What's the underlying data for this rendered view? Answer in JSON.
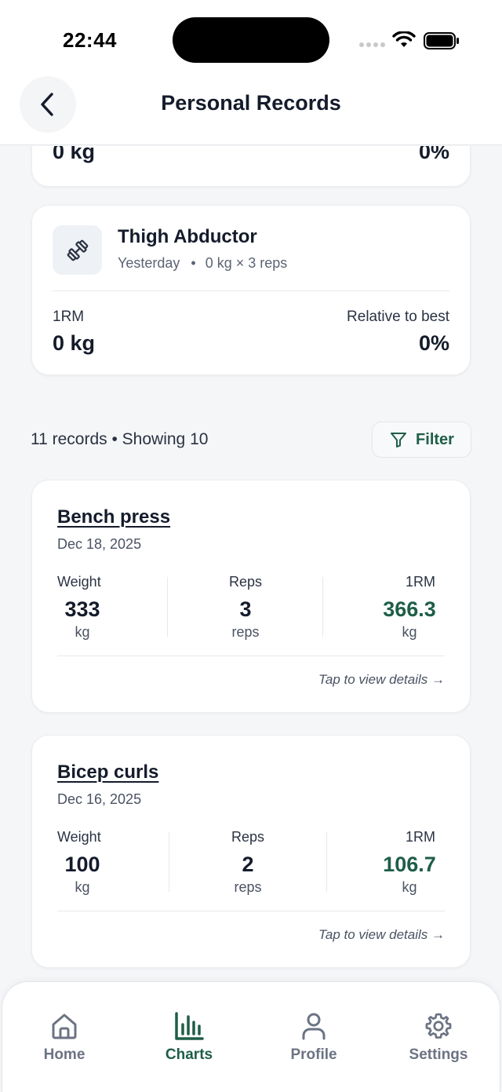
{
  "status_bar": {
    "time": "22:44"
  },
  "header": {
    "title": "Personal Records"
  },
  "previous_card": {
    "one_rm_value": "0 kg",
    "relative_value": "0%"
  },
  "pr_card": {
    "name": "Thigh Abductor",
    "when": "Yesterday",
    "separator": "•",
    "set": "0 kg × 3 reps",
    "one_rm_label": "1RM",
    "one_rm_value": "0 kg",
    "relative_label": "Relative to best",
    "relative_value": "0%",
    "icon": "dumbbell-icon"
  },
  "records_summary": "11 records • Showing 10",
  "filter": {
    "label": "Filter",
    "icon": "filter-icon"
  },
  "records": [
    {
      "name": "Bench press",
      "date": "Dec 18, 2025",
      "weight_label": "Weight",
      "weight_value": "333",
      "weight_unit": "kg",
      "reps_label": "Reps",
      "reps_value": "3",
      "reps_unit": "reps",
      "orm_label": "1RM",
      "orm_value": "366.3",
      "orm_unit": "kg",
      "hint": "Tap to view details →"
    },
    {
      "name": "Bicep curls",
      "date": "Dec 16, 2025",
      "weight_label": "Weight",
      "weight_value": "100",
      "weight_unit": "kg",
      "reps_label": "Reps",
      "reps_value": "2",
      "reps_unit": "reps",
      "orm_label": "1RM",
      "orm_value": "106.7",
      "orm_unit": "kg",
      "hint": "Tap to view details →"
    }
  ],
  "tabs": [
    {
      "label": "Home",
      "icon": "home-icon",
      "active": false
    },
    {
      "label": "Charts",
      "icon": "bar-chart-icon",
      "active": true
    },
    {
      "label": "Profile",
      "icon": "person-icon",
      "active": false
    },
    {
      "label": "Settings",
      "icon": "gear-icon",
      "active": false
    }
  ],
  "colors": {
    "accent": "#1e5e47",
    "text": "#141b2b",
    "muted": "#6b7383",
    "background": "#f5f6f8"
  }
}
